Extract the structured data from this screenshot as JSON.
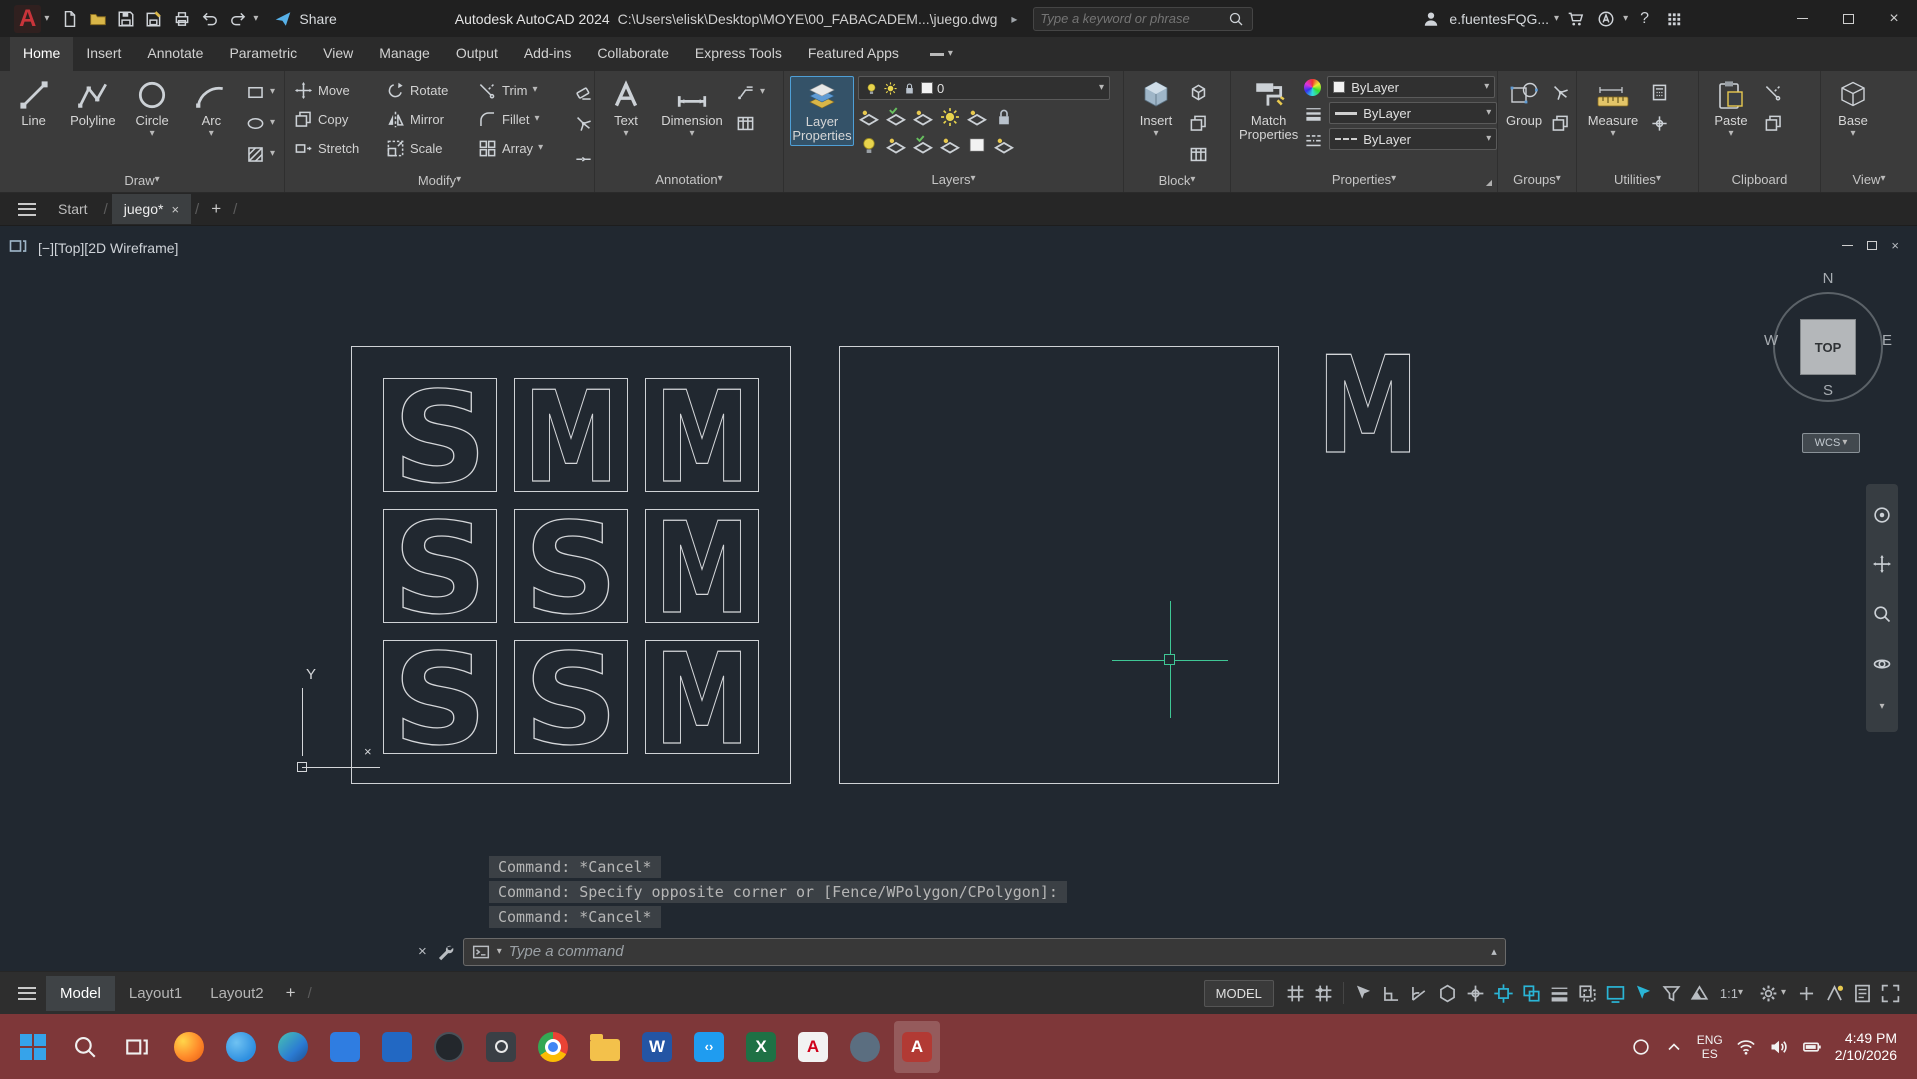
{
  "titlebar": {
    "app_title": "Autodesk AutoCAD 2024",
    "doc_path": "C:\\Users\\elisk\\Desktop\\MOYE\\00_FABACADEM...\\juego.dwg",
    "share": "Share",
    "search_placeholder": "Type a keyword or phrase",
    "user": "e.fuentesFQG..."
  },
  "ribbon": {
    "tabs": [
      "Home",
      "Insert",
      "Annotate",
      "Parametric",
      "View",
      "Manage",
      "Output",
      "Add-ins",
      "Collaborate",
      "Express Tools",
      "Featured Apps"
    ],
    "draw": {
      "label": "Draw",
      "line": "Line",
      "polyline": "Polyline",
      "circle": "Circle",
      "arc": "Arc"
    },
    "modify": {
      "label": "Modify",
      "move": "Move",
      "rotate": "Rotate",
      "trim": "Trim",
      "copy": "Copy",
      "mirror": "Mirror",
      "fillet": "Fillet",
      "stretch": "Stretch",
      "scale": "Scale",
      "array": "Array"
    },
    "annotation": {
      "label": "Annotation",
      "text": "Text",
      "dimension": "Dimension"
    },
    "layers": {
      "label": "Layers",
      "layer_properties": "Layer\nProperties",
      "current_layer": "0"
    },
    "block": {
      "label": "Block",
      "insert": "Insert"
    },
    "properties": {
      "label": "Properties",
      "match": "Match\nProperties",
      "color": "ByLayer",
      "lineweight": "ByLayer",
      "linetype": "ByLayer"
    },
    "groups": {
      "label": "Groups",
      "group": "Group"
    },
    "utilities": {
      "label": "Utilities",
      "measure": "Measure"
    },
    "clipboard": {
      "label": "Clipboard",
      "paste": "Paste"
    },
    "view": {
      "label": "View",
      "base": "Base"
    }
  },
  "file_tabs": {
    "start": "Start",
    "active": "juego*"
  },
  "viewport": {
    "controls": "[−][Top][2D Wireframe]",
    "viewcube": {
      "n": "N",
      "e": "E",
      "s": "S",
      "w": "W",
      "top": "TOP",
      "wcs": "WCS"
    }
  },
  "canvas": {
    "letters": [
      [
        "S",
        "M",
        "M"
      ],
      [
        "S",
        "S",
        "M"
      ],
      [
        "S",
        "S",
        "M"
      ]
    ],
    "floating_letter": "M",
    "ucs_y": "Y",
    "ucs_x": "×"
  },
  "command": {
    "history": [
      "Command: *Cancel*",
      "Command: Specify opposite corner or [Fence/WPolygon/CPolygon]:",
      "Command: *Cancel*"
    ],
    "placeholder": "Type a command"
  },
  "layout_tabs": {
    "model": "Model",
    "layout1": "Layout1",
    "layout2": "Layout2"
  },
  "statusbar": {
    "model": "MODEL",
    "scale": "1:1"
  },
  "taskbar": {
    "lang_top": "ENG",
    "lang_bottom": "ES",
    "time": "4:49 PM",
    "date": "2/10/2026",
    "glyphs": {
      "word": "W",
      "excel": "X",
      "acrobat": "A",
      "autocad": "A",
      "vscode": "‹›",
      "logo": "A"
    }
  },
  "icons": {
    "close": "×",
    "arrow_right": "▸",
    "caret_up": "▴",
    "help": "?",
    "caret_down": "▾",
    "slash": "/",
    "plus": "+"
  },
  "colors": {
    "accent_teal": "#2ab5d6",
    "crosshair": "#3fc795",
    "taskbar": "#7e3739",
    "canvas_bg": "#212830"
  }
}
